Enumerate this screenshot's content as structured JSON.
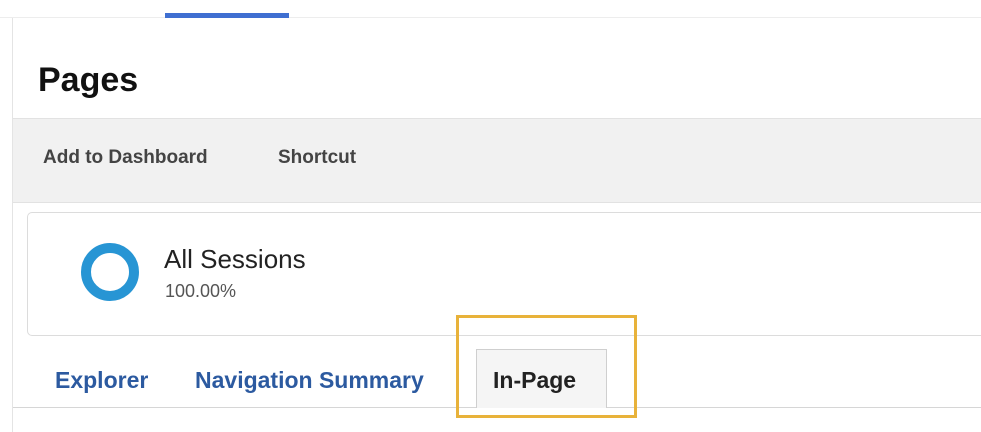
{
  "page": {
    "title": "Pages"
  },
  "action_bar": {
    "add_to_dashboard_label": "Add to Dashboard",
    "shortcut_label": "Shortcut"
  },
  "segment": {
    "name": "All Sessions",
    "percentage": "100.00%",
    "ring_color": "#2795d4",
    "icon": "donut-ring-icon"
  },
  "tabs": [
    {
      "label": "Explorer",
      "active": false
    },
    {
      "label": "Navigation Summary",
      "active": false
    },
    {
      "label": "In-Page",
      "active": true
    }
  ],
  "colors": {
    "tab_link": "#2c5aa0",
    "highlight": "#e8b23a",
    "top_indicator": "#3f6fd1"
  }
}
